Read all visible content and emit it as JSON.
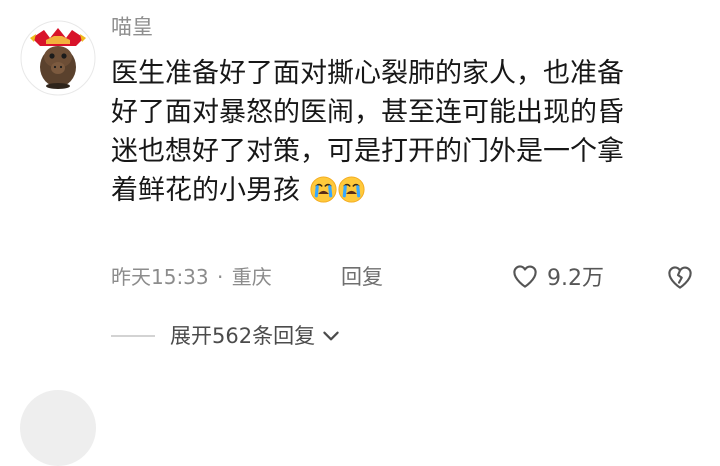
{
  "comment": {
    "username": "喵皇",
    "text_lines": [
      "医生准备好了面对撕心裂肺的家人，也准备",
      "好了面对暴怒的医闹，甚至连可能出现的昏",
      "迷也想好了对策，可是打开的门外是一个拿",
      "着鲜花的小男孩"
    ],
    "emojis": [
      "crying-face-emoji",
      "crying-face-emoji"
    ],
    "timestamp": "昨天15:33",
    "separator": "·",
    "location": "重庆",
    "reply_label": "回复",
    "like_count": "9.2万",
    "icons": {
      "like": "heart-outline-icon",
      "dislike": "broken-heart-icon",
      "expand": "chevron-down-icon"
    }
  },
  "replies": {
    "expand_label": "展开562条回复"
  },
  "colors": {
    "username": "#8f8f8f",
    "text": "#171717",
    "meta": "#8c8c8c",
    "emoji": "#ffc93b",
    "divider": "#d3d3d3"
  }
}
